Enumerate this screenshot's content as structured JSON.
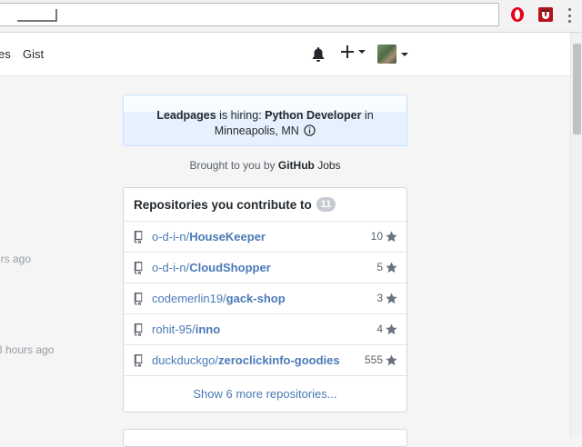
{
  "browser": {
    "extensions": [
      "opera-icon",
      "magnet-icon"
    ],
    "menu": "kebab-menu-icon"
  },
  "header": {
    "nav": {
      "issues": "es",
      "gist": "Gist"
    },
    "icons": [
      "bell-icon",
      "plus-icon",
      "avatar"
    ]
  },
  "timeline": {
    "time1": "urs ago",
    "time2": "3 hours ago"
  },
  "job_ad": {
    "company": "Leadpages",
    "is_hiring": " is hiring: ",
    "role": "Python Developer",
    "in": " in",
    "location": "Minneapolis, MN",
    "brought_prefix": "Brought to you by ",
    "brought_brand": "GitHub",
    "brought_suffix": " Jobs"
  },
  "repos": {
    "title": "Repositories you contribute to",
    "count": "11",
    "items": [
      {
        "owner": "o-d-i-n/",
        "name": "HouseKeeper",
        "stars": "10"
      },
      {
        "owner": "o-d-i-n/",
        "name": "CloudShopper",
        "stars": "5"
      },
      {
        "owner": "codemerlin19/",
        "name": "gack-shop",
        "stars": "3"
      },
      {
        "owner": "rohit-95/",
        "name": "inno",
        "stars": "4"
      },
      {
        "owner": "duckduckgo/",
        "name": "zeroclickinfo-goodies",
        "stars": "555"
      }
    ],
    "more_label": "Show 6 more repositories..."
  },
  "colors": {
    "link": "#4a7ab8",
    "job_bg": "#e6f1fd",
    "counter_bg": "#c6cbd1"
  }
}
